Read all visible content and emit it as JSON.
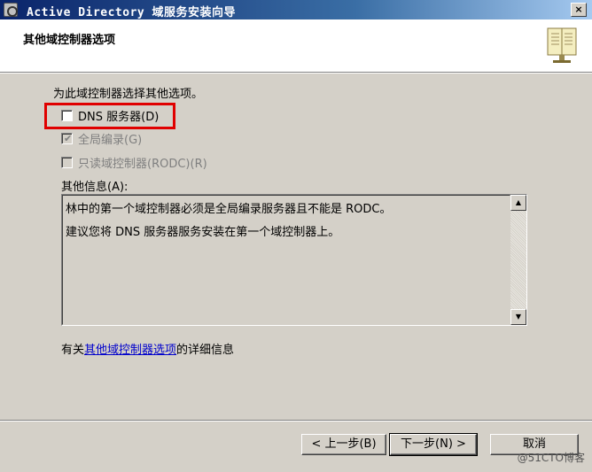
{
  "window": {
    "title": "Active Directory 域服务安装向导",
    "close_label": "×"
  },
  "header": {
    "title": "其他域控制器选项",
    "icon": "book-icon"
  },
  "main": {
    "instruction": "为此域控制器选择其他选项。",
    "options": [
      {
        "label": "DNS 服务器(D)",
        "checked": false,
        "enabled": true
      },
      {
        "label": "全局编录(G)",
        "checked": true,
        "enabled": false
      },
      {
        "label": "只读域控制器(RODC)(R)",
        "checked": false,
        "enabled": false
      }
    ],
    "info_label": "其他信息(A):",
    "info_lines": [
      "林中的第一个域控制器必须是全局编录服务器且不能是 RODC。",
      "建议您将 DNS 服务器服务安装在第一个域控制器上。"
    ],
    "more_info_prefix": "有关",
    "more_info_link": "其他域控制器选项",
    "more_info_suffix": "的详细信息"
  },
  "footer": {
    "back_label": "< 上一步(B)",
    "next_label": "下一步(N) >",
    "cancel_label": "取消"
  },
  "watermark": "@51CTO博客",
  "colors": {
    "highlight": "#e00000",
    "title_bar": "#0a246a",
    "link": "#0000cc"
  }
}
